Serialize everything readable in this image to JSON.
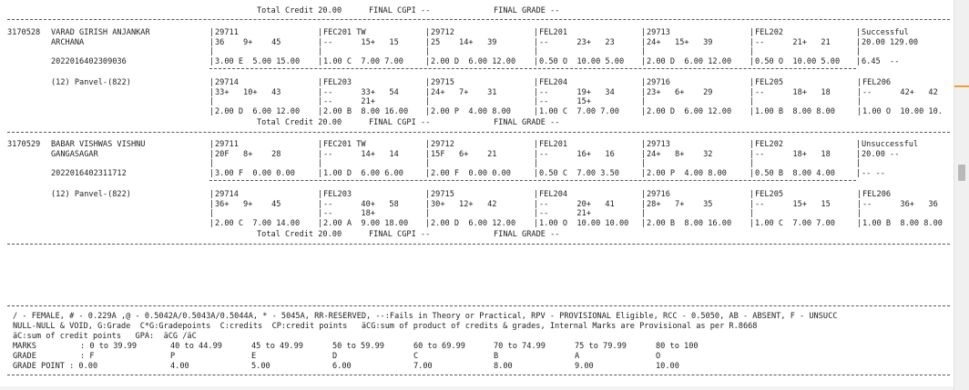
{
  "summary_top": {
    "credit": "Total Credit 20.00",
    "cgpi": "FINAL CGPI --",
    "grade": "FINAL GRADE --"
  },
  "students": [
    {
      "seat": "3170528",
      "name_line1": "VARAD GIRISH ANJANKAR",
      "name_line2": "ARCHANA",
      "prn": "2022016402309036",
      "college": "(12) Panvel-(822)",
      "result_l1": "Successful",
      "result_l2": "20.00 129.00",
      "sgpi": "6.45  --",
      "block1": {
        "codes": [
          "29711",
          "FEC201 TW",
          "29712",
          "FEL201",
          "29713",
          "FEL202"
        ],
        "marks": [
          "36    9+    45",
          "--      15+   15",
          "25    14+   39",
          "--      23+   23",
          "24+   15+   39",
          "--      21+   21"
        ],
        "extra": [
          "",
          "",
          "",
          "",
          "",
          ""
        ],
        "grades": [
          "3.00 E  5.00 15.00",
          "1.00 C  7.00 7.00",
          "2.00 D  6.00 12.00",
          "0.50 O  10.00 5.00",
          "2.00 D  6.00 12.00",
          "0.50 O  10.00 5.00"
        ]
      },
      "block2": {
        "codes": [
          "29714",
          "FEL203",
          "29715",
          "FEL204",
          "29716",
          "FEL205",
          "FEL206"
        ],
        "marks": [
          "33+   10+   43",
          "--      33+   54",
          "24+   7+    31",
          "--      19+   34",
          "23+   6+    29",
          "--      18+   18",
          "--      42+   42"
        ],
        "extra": [
          "",
          "--      21+",
          "",
          "--      15+",
          "",
          "",
          ""
        ],
        "grades": [
          "2.00 D  6.00 12.00",
          "2.00 B  8.00 16.00",
          "2.00 P  4.00 8.00",
          "1.00 C  7.00 7.00",
          "2.00 D  6.00 12.00",
          "1.00 B  8.00 8.00",
          "1.00 O  10.00 10."
        ]
      },
      "totals": {
        "credit": "Total Credit 20.00",
        "cgpi": "FINAL CGPI --",
        "grade": "FINAL GRADE --"
      }
    },
    {
      "seat": "3170529",
      "name_line1": "BABAR VISHWAS VISHNU",
      "name_line2": "GANGASAGAR",
      "prn": "2022016402311712",
      "college": "(12) Panvel-(822)",
      "result_l1": "Unsuccessful",
      "result_l2": "20.00 --",
      "sgpi": "-- --",
      "block1": {
        "codes": [
          "29711",
          "FEC201 TW",
          "29712",
          "FEL201",
          "29713",
          "FEL202"
        ],
        "marks": [
          "20F   8+    28",
          "--      14+   14",
          "15F   6+    21",
          "--      16+   16",
          "24+   8+    32",
          "--      18+   18"
        ],
        "extra": [
          "",
          "",
          "",
          "",
          "",
          ""
        ],
        "grades": [
          "3.00 F  0.00 0.00",
          "1.00 D  6.00 6.00",
          "2.00 F  0.00 0.00",
          "0.50 C  7.00 3.50",
          "2.00 P  4.00 8.00",
          "0.50 B  8.00 4.00"
        ]
      },
      "block2": {
        "codes": [
          "29714",
          "FEL203",
          "29715",
          "FEL204",
          "29716",
          "FEL205",
          "FEL206"
        ],
        "marks": [
          "36+   9+    45",
          "--      40+   58",
          "30+   12+   42",
          "--      20+   41",
          "28+   7+    35",
          "--      15+   15",
          "--      36+   36"
        ],
        "extra": [
          "",
          "--      18+",
          "",
          "--      21+",
          "",
          "",
          ""
        ],
        "grades": [
          "2.00 C  7.00 14.00",
          "2.00 A  9.00 18.00",
          "2.00 D  6.00 12.00",
          "1.00 O  10.00 10.00",
          "2.00 B  8.00 16.00",
          "1.00 C  7.00 7.00",
          "1.00 B  8.00 8.00"
        ]
      },
      "totals": {
        "credit": "Total Credit 20.00",
        "cgpi": "FINAL CGPI --",
        "grade": "FINAL GRADE --"
      }
    }
  ],
  "legend": {
    "line1": "/ - FEMALE, # - 0.229A ,@ - 0.5042A/0.5043A/0.5044A, * - 5045A, RR-RESERVED, --:Fails in Theory or Practical, RPV - PROVISIONAL Eligible, RCC - 0.5050, AB - ABSENT, F - UNSUCC",
    "line2": "NULL-NULL & VOID, G:Grade  C*G:Gradepoints  C:credits  CP:credit points   äCG:sum of product of credits & grades, Internal Marks are Provisional as per R.8668",
    "line3": "äC:sum of credit points   GPA:  äCG /äC",
    "marks_label": "MARKS",
    "marks": [
      ": 0 to 39.99",
      "40 to 44.99",
      "45 to 49.99",
      "50 to 59.99",
      "60 to 69.99",
      "70 to 74.99",
      "75 to 79.99",
      "80 to 100"
    ],
    "grade_label": "GRADE",
    "grades": [
      ": F",
      "P",
      "E",
      "D",
      "C",
      "B",
      "A",
      "O"
    ],
    "gp_label": "GRADE POINT : 0.00",
    "gps": [
      "4.00",
      "5.00",
      "6.00",
      "7.00",
      "8.00",
      "9.00",
      "10.00"
    ]
  }
}
